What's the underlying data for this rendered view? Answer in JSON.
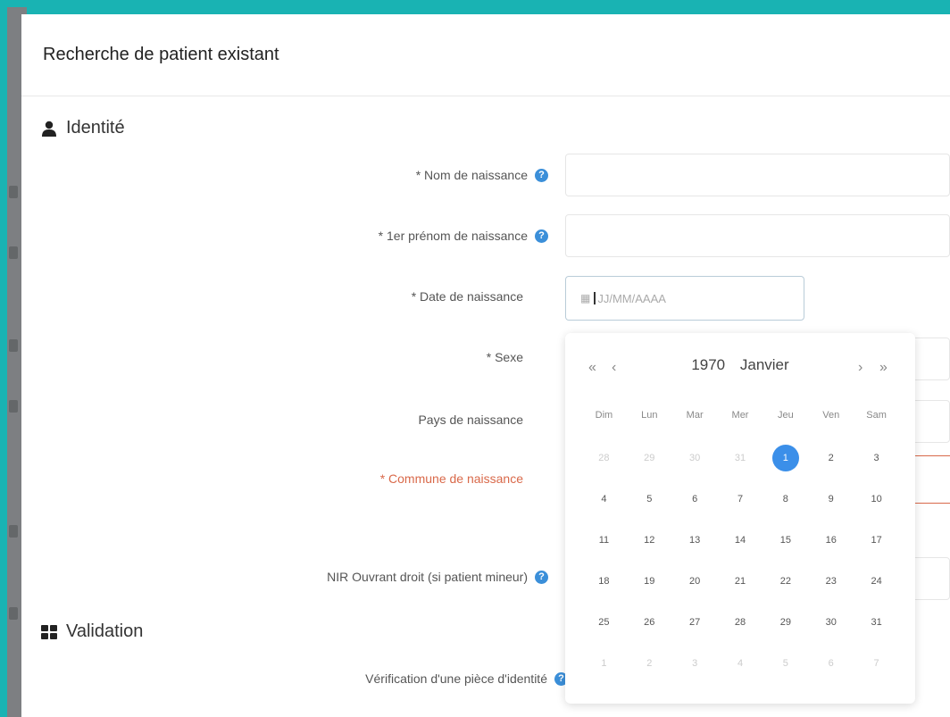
{
  "modal": {
    "title": "Recherche de patient existant"
  },
  "sections": {
    "identity_title": "Identité",
    "validation_title": "Validation"
  },
  "form": {
    "birth_name_label": "* Nom de naissance",
    "first_name_label": "* 1er prénom de naissance",
    "birth_date_label": "* Date de naissance",
    "sex_label": "* Sexe",
    "birth_country_label": "Pays de naissance",
    "birth_commune_label": "* Commune de naissance",
    "nir_label": "NIR Ouvrant droit (si patient mineur)",
    "id_check_label": "Vérification d'une pièce d'identité",
    "birth_date_placeholder": "JJ/MM/AAAA"
  },
  "datepicker": {
    "year": "1970",
    "month": "Janvier",
    "nav": {
      "prev_year": "«",
      "prev_month": "‹",
      "next_month": "›",
      "next_year": "»"
    },
    "weekdays": [
      "Dim",
      "Lun",
      "Mar",
      "Mer",
      "Jeu",
      "Ven",
      "Sam"
    ],
    "weeks": [
      [
        {
          "d": "28",
          "m": true
        },
        {
          "d": "29",
          "m": true
        },
        {
          "d": "30",
          "m": true
        },
        {
          "d": "31",
          "m": true
        },
        {
          "d": "1",
          "s": true
        },
        {
          "d": "2"
        },
        {
          "d": "3"
        }
      ],
      [
        {
          "d": "4"
        },
        {
          "d": "5"
        },
        {
          "d": "6"
        },
        {
          "d": "7"
        },
        {
          "d": "8"
        },
        {
          "d": "9"
        },
        {
          "d": "10"
        }
      ],
      [
        {
          "d": "11"
        },
        {
          "d": "12"
        },
        {
          "d": "13"
        },
        {
          "d": "14"
        },
        {
          "d": "15"
        },
        {
          "d": "16"
        },
        {
          "d": "17"
        }
      ],
      [
        {
          "d": "18"
        },
        {
          "d": "19"
        },
        {
          "d": "20"
        },
        {
          "d": "21"
        },
        {
          "d": "22"
        },
        {
          "d": "23"
        },
        {
          "d": "24"
        }
      ],
      [
        {
          "d": "25"
        },
        {
          "d": "26"
        },
        {
          "d": "27"
        },
        {
          "d": "28"
        },
        {
          "d": "29"
        },
        {
          "d": "30"
        },
        {
          "d": "31"
        }
      ],
      [
        {
          "d": "1",
          "m": true
        },
        {
          "d": "2",
          "m": true
        },
        {
          "d": "3",
          "m": true
        },
        {
          "d": "4",
          "m": true
        },
        {
          "d": "5",
          "m": true
        },
        {
          "d": "6",
          "m": true
        },
        {
          "d": "7",
          "m": true
        }
      ]
    ]
  },
  "colors": {
    "accent": "#3b8fe9",
    "frame": "#19b3b3",
    "required_red": "#d9694a"
  }
}
